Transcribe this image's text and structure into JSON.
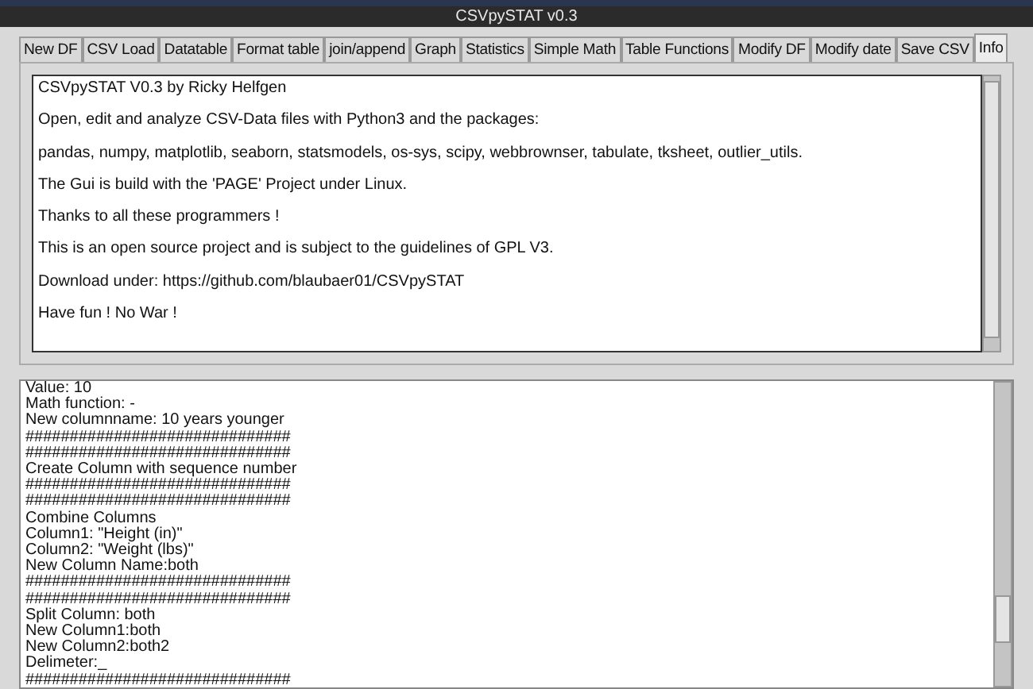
{
  "window": {
    "title": "CSVpySTAT v0.3"
  },
  "tabs": [
    {
      "label": "New DF",
      "selected": false
    },
    {
      "label": "CSV Load",
      "selected": false
    },
    {
      "label": "Datatable",
      "selected": false
    },
    {
      "label": "Format table",
      "selected": false
    },
    {
      "label": "join/append",
      "selected": false
    },
    {
      "label": "Graph",
      "selected": false
    },
    {
      "label": "Statistics",
      "selected": false
    },
    {
      "label": "Simple Math",
      "selected": false
    },
    {
      "label": "Table Functions",
      "selected": false
    },
    {
      "label": "Modify DF",
      "selected": false
    },
    {
      "label": "Modify date",
      "selected": false
    },
    {
      "label": "Save CSV",
      "selected": false
    },
    {
      "label": "Info",
      "selected": true
    }
  ],
  "info_text": [
    "CSVpySTAT V0.3 by Ricky Helfgen",
    "Open, edit and analyze CSV-Data files with Python3 and the packages:",
    "pandas, numpy, matplotlib, seaborn, statsmodels, os-sys, scipy, webbrownser, tabulate, tksheet, outlier_utils.",
    "The Gui is build with the 'PAGE' Project under Linux.",
    "Thanks to all these programmers !",
    "This is an open source project and is subject to the guidelines of GPL V3.",
    "Download under: https://github.com/blaubaer01/CSVpySTAT",
    "Have fun ! No War !"
  ],
  "log_lines": [
    "Value: 10",
    "Math function: -",
    "New columnname: 10 years younger",
    "##############################",
    "##############################",
    "Create Column with sequence number",
    "##############################",
    "##############################",
    "Combine Columns",
    "Column1: \"Height (in)\"",
    "Column2: \"Weight (lbs)\"",
    "New Column Name:both",
    "##############################",
    "##############################",
    "Split Column: both",
    "New Column1:both",
    "New Column2:both2",
    "Delimeter:_",
    "##############################"
  ]
}
